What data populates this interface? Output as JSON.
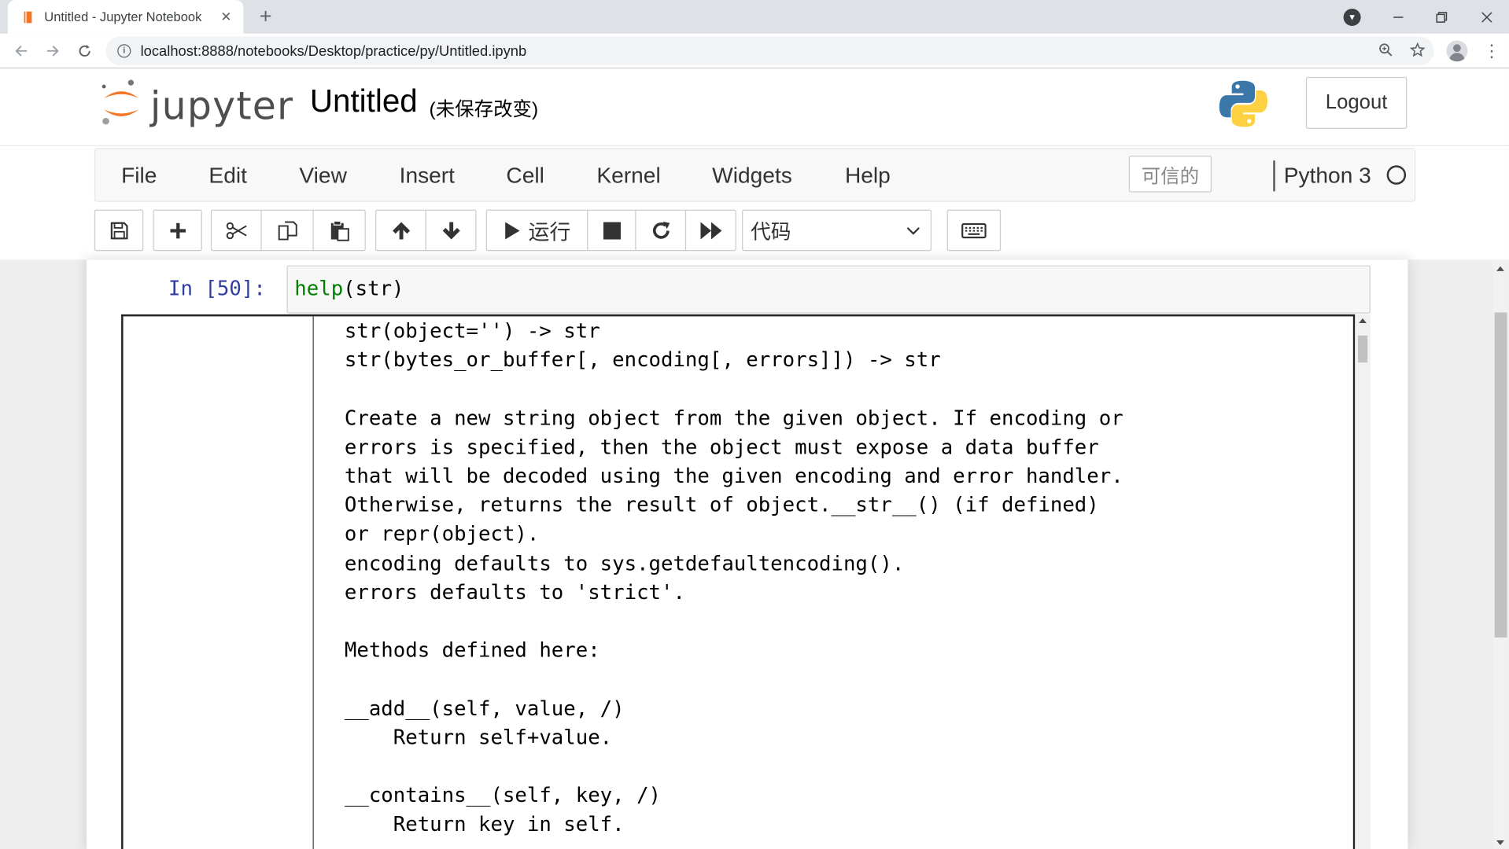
{
  "browser": {
    "tab_title": "Untitled - Jupyter Notebook",
    "tab_close": "✕",
    "new_tab": "+",
    "url": "localhost:8888/notebooks/Desktop/practice/py/Untitled.ipynb"
  },
  "header": {
    "logo_text": "jupyter",
    "notebook_title": "Untitled",
    "save_status": "(未保存改变)",
    "logout_label": "Logout"
  },
  "menubar": {
    "items": [
      "File",
      "Edit",
      "View",
      "Insert",
      "Cell",
      "Kernel",
      "Widgets",
      "Help"
    ],
    "trusted_label": "可信的",
    "kernel_name": "Python 3"
  },
  "toolbar": {
    "run_label": "运行",
    "cell_type": "代码"
  },
  "cell": {
    "prompt": "In  [50]:",
    "code_func": "help",
    "code_arg": "str",
    "output_lines": [
      "str(object='') -> str",
      "str(bytes_or_buffer[, encoding[, errors]]) -> str",
      "",
      "Create a new string object from the given object. If encoding or",
      "errors is specified, then the object must expose a data buffer",
      "that will be decoded using the given encoding and error handler.",
      "Otherwise, returns the result of object.__str__() (if defined)",
      "or repr(object).",
      "encoding defaults to sys.getdefaultencoding().",
      "errors defaults to 'strict'.",
      "",
      "Methods defined here:",
      "",
      "__add__(self, value, /)",
      "    Return self+value.",
      "",
      "__contains__(self, key, /)",
      "    Return key in self."
    ]
  },
  "colors": {
    "jupyter_orange": "#f37726",
    "prompt_blue": "#303f9f",
    "code_green": "#008000"
  }
}
